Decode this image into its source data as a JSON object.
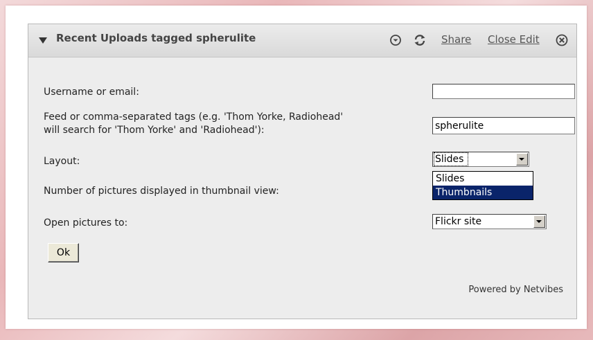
{
  "widget": {
    "title": "Recent Uploads tagged spherulite",
    "header": {
      "share_label": "Share",
      "close_edit_label": "Close Edit",
      "icons": [
        "collapse-arrow-icon",
        "menu-circle-icon",
        "refresh-icon",
        "close-circle-icon"
      ]
    },
    "form": {
      "username": {
        "label": "Username or email:",
        "value": ""
      },
      "tags": {
        "label_line1": "Feed or comma-separated tags (e.g. 'Thom Yorke, Radiohead'",
        "label_line2": "will search for 'Thom Yorke' and 'Radiohead'):",
        "value": "spherulite"
      },
      "layout": {
        "label": "Layout:",
        "selected": "Slides",
        "options": [
          "Slides",
          "Thumbnails"
        ],
        "highlighted": "Thumbnails"
      },
      "thumbnail_count": {
        "label": "Number of pictures displayed in thumbnail view:"
      },
      "open_pictures": {
        "label": "Open pictures to:",
        "selected": "Flickr site"
      },
      "ok_label": "Ok"
    },
    "footer": {
      "powered_by": "Powered by Netvibes"
    }
  },
  "colors": {
    "header_bg": "#dedede",
    "body_bg": "#ededed",
    "selection": "#0a246a",
    "page_bg": "#e9b7b9"
  }
}
